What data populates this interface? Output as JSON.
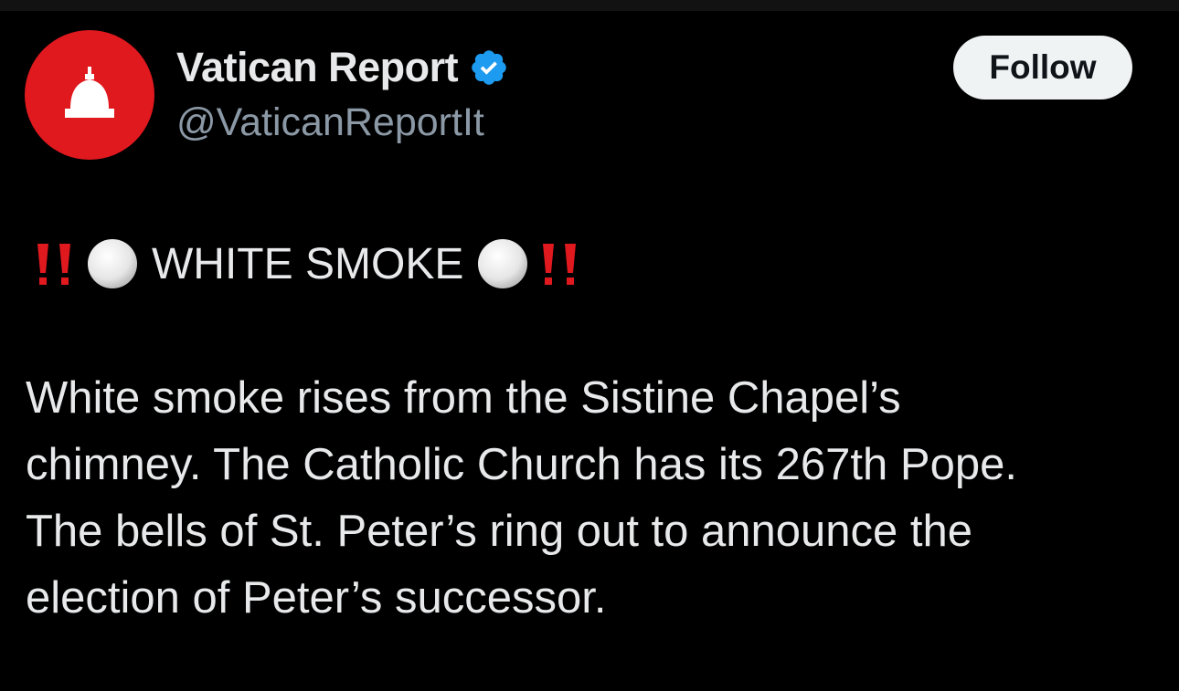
{
  "author": {
    "display_name": "Vatican Report",
    "handle": "@VaticanReportIt",
    "verified": true,
    "avatar_icon": "dome-icon",
    "avatar_color": "#e0191f"
  },
  "follow_button": {
    "label": "Follow"
  },
  "post": {
    "headline": "WHITE SMOKE",
    "headline_emoji_outer": "double-exclamation-icon",
    "headline_emoji_inner": "white-circle-icon",
    "body": "White smoke rises from the Sistine Chapel’s\nchimney. The Catholic Church has its 267th Pope.\nThe bells of St. Peter’s ring out to announce the\nelection of Peter’s successor."
  },
  "colors": {
    "background": "#000000",
    "text": "#e7e9ea",
    "secondary_text": "#8b98a5",
    "verified_badge": "#1d9bf0",
    "emoji_red": "#e0191f"
  }
}
